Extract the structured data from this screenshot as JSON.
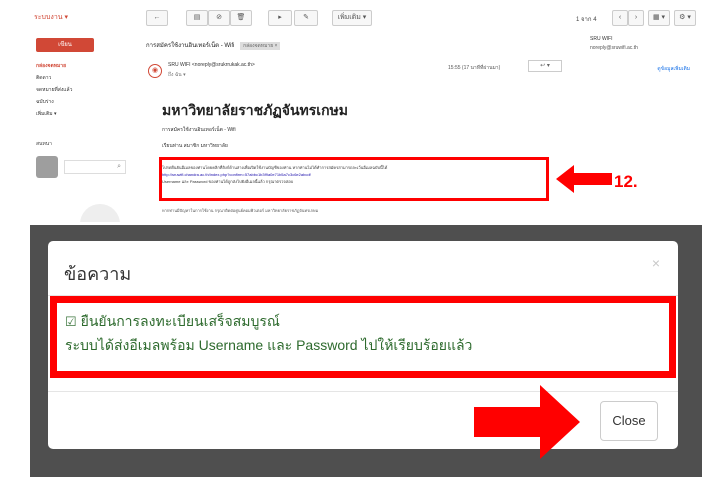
{
  "mail": {
    "brand": "ระบบงาน ▾",
    "compose": "เขียน",
    "folders": [
      "กล่องจดหมาย",
      "ติดดาว",
      "จดหมายที่ส่งแล้ว",
      "ฉบับร่าง",
      "เพิ่มเติม ▾"
    ],
    "chat_label": "สนทนา",
    "chat_search_icon": "search-icon",
    "toolbar": {
      "back": "←",
      "archive": "▤",
      "spam": "⊘",
      "delete": "🗑",
      "move": "▸",
      "labels": "✎",
      "more": "เพิ่มเติม ▾",
      "count": "1 จาก 4",
      "prev": "‹",
      "next": "›",
      "view": "▦ ▾",
      "settings": "⚙ ▾"
    },
    "subject": "การสมัครใช้งานอินเทอร์เน็ต - Wifi",
    "inbox_badge": "กล่องจดหมาย ×",
    "sender": "SRU WIFI <noreply@srukrrukak.ac.th>",
    "to_me": "ถึง ฉัน ▾",
    "date": "15:55 (17 นาทีที่ผ่านมา)",
    "reply": "↩ ▾",
    "side": {
      "name": "SRU WIFI",
      "email": "noreply@sruwifi.ac.th",
      "more": "ดูข้อมูลเพิ่มเติม"
    },
    "university": "มหาวิทยาลัยราชภัฏจันทรเกษม",
    "line1": "การสมัครใช้งานอินเทอร์เน็ต - Wifi",
    "line2": "เรียนท่าน สมาชิก มหาวิทยาลัย",
    "body_text": "โปรดยืนยันอีเมลของท่านโดยคลิกที่ลิงก์ด้านล่างเพื่อเปิดใช้งานบัญชีของท่าน หากท่านไม่ได้ทำการสมัครสามารถละเว้นอีเมลฉบับนี้ได้",
    "body_link": "http://sruwifi.chandra.ac.th/index.php?confirm=57abbc1b3f9a0e71b5a7c3c6e2abcdf",
    "body_tail": "Username และ Password ของท่านได้ถูกส่งไปยังอีเมลนี้แล้ว กรุณาตรวจสอบ",
    "footer": "หากท่านมีปัญหาในการใช้งาน กรุณาติดต่อศูนย์คอมพิวเตอร์ มหาวิทยาลัยราชภัฏจันทรเกษม"
  },
  "annotation": {
    "step_label": "12."
  },
  "dialog": {
    "title": "ข้อความ",
    "close_x": "×",
    "confirm_icon": "check-square-icon",
    "confirm_line1": "ยืนยันการลงทะเบียนเสร็จสมบูรณ์",
    "confirm_line2": "ระบบได้ส่งอีเมลพร้อม Username และ Password ไปให้เรียบร้อยแล้ว",
    "close_button": "Close"
  },
  "colors": {
    "highlight": "#ff0000",
    "success_text": "#2d6a2d",
    "gmail_red": "#d14836",
    "overlay": "#4f4f4f"
  }
}
